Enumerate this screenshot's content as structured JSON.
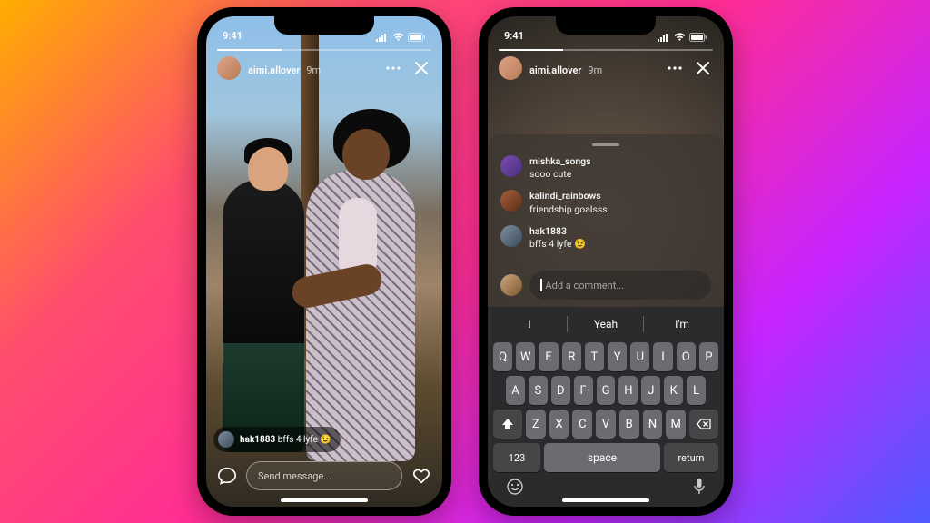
{
  "status": {
    "time": "9:41"
  },
  "phone_a": {
    "user": "aimi.allover",
    "time": "9m",
    "comment_user": "hak1883",
    "comment_text": "bffs 4 lyfe",
    "comment_emoji": "😉",
    "message_placeholder": "Send message..."
  },
  "phone_b": {
    "user": "aimi.allover",
    "time": "9m",
    "comments": [
      {
        "user": "mishka_songs",
        "text": "sooo cute"
      },
      {
        "user": "kalindi_rainbows",
        "text": "friendship goalsss"
      },
      {
        "user": "hak1883",
        "text": "bffs 4 lyfe 😉"
      }
    ],
    "add_comment_placeholder": "Add a comment..."
  },
  "keyboard": {
    "suggestions": [
      "I",
      "Yeah",
      "I'm"
    ],
    "row1": [
      "Q",
      "W",
      "E",
      "R",
      "T",
      "Y",
      "U",
      "I",
      "O",
      "P"
    ],
    "row2": [
      "A",
      "S",
      "D",
      "F",
      "G",
      "H",
      "J",
      "K",
      "L"
    ],
    "row3": [
      "Z",
      "X",
      "C",
      "V",
      "B",
      "N",
      "M"
    ],
    "num": "123",
    "space": "space",
    "return": "return"
  }
}
